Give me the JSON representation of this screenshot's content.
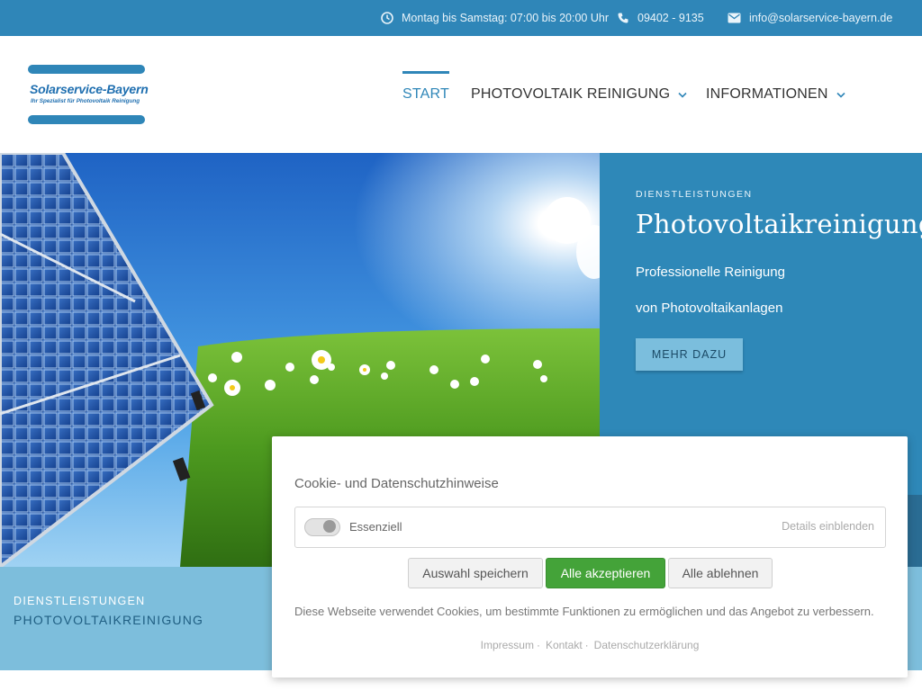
{
  "topbar": {
    "hours": "Montag bis Samstag: 07:00 bis 20:00 Uhr",
    "phone": "09402 - 9135",
    "email": "info@solarservice-bayern.de",
    "icons": [
      "clock-icon",
      "phone-icon",
      "mail-icon"
    ]
  },
  "logo": {
    "name": "Solarservice-Bayern",
    "tagline": "Ihr Spezialist für Photovoltaik Reinigung"
  },
  "nav": {
    "items": [
      {
        "label": "START",
        "active": true
      },
      {
        "label": "PHOTOVOLTAIK REINIGUNG",
        "dropdown": true
      },
      {
        "label": "INFORMATIONEN",
        "dropdown": true
      }
    ]
  },
  "hero": {
    "kicker": "DIENSTLEISTUNGEN",
    "title": "Photovoltaikreinigung",
    "line1": "Professionelle Reinigung",
    "line2": "von Photovoltaikanlagen",
    "button": "MEHR DAZU"
  },
  "breadcrumb": {
    "kicker": "DIENSTLEISTUNGEN",
    "title": "PHOTOVOLTAIKREINIGUNG"
  },
  "cookie": {
    "title": "Cookie- und Datenschutzhinweise",
    "category": "Essenziell",
    "details": "Details einblenden",
    "buttons": {
      "save": "Auswahl speichern",
      "accept": "Alle akzeptieren",
      "reject": "Alle ablehnen"
    },
    "text": "Diese Webseite verwendet Cookies, um bestimmte Funktionen zu ermöglichen und das Angebot zu verbessern.",
    "links": {
      "impressum": "Impressum",
      "kontakt": "Kontakt",
      "datenschutz": "Datenschutzerklärung"
    }
  },
  "colors": {
    "brand": "#2f86b8",
    "accept": "#44a339",
    "band": "#7dbedc"
  }
}
